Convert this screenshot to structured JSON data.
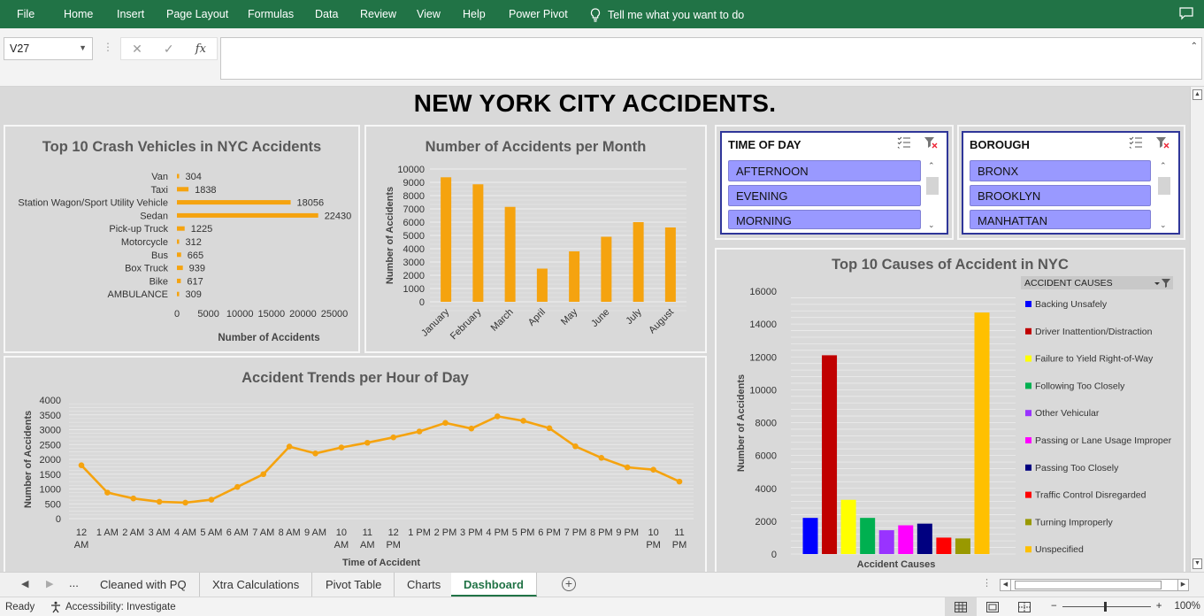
{
  "ribbon": {
    "tabs": [
      "File",
      "Home",
      "Insert",
      "Page Layout",
      "Formulas",
      "Data",
      "Review",
      "View",
      "Help",
      "Power Pivot"
    ],
    "tell_me": "Tell me what you want to do"
  },
  "formula_bar": {
    "name_box": "V27",
    "formula": ""
  },
  "dashboard": {
    "title": "NEW YORK CITY ACCIDENTS."
  },
  "slicers": [
    {
      "header": "TIME OF DAY",
      "items": [
        "AFTERNOON",
        "EVENING",
        "MORNING"
      ]
    },
    {
      "header": "BOROUGH",
      "items": [
        "BRONX",
        "BROOKLYN",
        "MANHATTAN"
      ]
    }
  ],
  "chart_data": [
    {
      "type": "bar",
      "orientation": "horizontal",
      "title": "Top 10 Crash Vehicles in NYC Accidents",
      "xlabel": "Number of Accidents",
      "ylabel": "",
      "categories": [
        "Van",
        "Taxi",
        "Station Wagon/Sport Utility Vehicle",
        "Sedan",
        "Pick-up Truck",
        "Motorcycle",
        "Bus",
        "Box Truck",
        "Bike",
        "AMBULANCE"
      ],
      "values": [
        304,
        1838,
        18056,
        22430,
        1225,
        312,
        665,
        939,
        617,
        309
      ],
      "xlim": [
        0,
        25000
      ],
      "xticks": [
        "0",
        "5000",
        "10000",
        "15000",
        "20000",
        "25000"
      ],
      "color": "#f5a30f",
      "data_labels": true
    },
    {
      "type": "bar",
      "title": "Number of Accidents per Month",
      "xlabel": "",
      "ylabel": "Number of Accidents",
      "categories": [
        "January",
        "February",
        "March",
        "April",
        "May",
        "June",
        "July",
        "August"
      ],
      "values": [
        9380,
        8850,
        7150,
        2500,
        3800,
        4900,
        6000,
        5600
      ],
      "ylim": [
        0,
        10000
      ],
      "yticks": [
        "0",
        "1000",
        "2000",
        "3000",
        "4000",
        "5000",
        "6000",
        "7000",
        "8000",
        "9000",
        "10000"
      ],
      "color": "#f5a30f"
    },
    {
      "type": "line",
      "title": "Accident Trends per Hour of Day",
      "xlabel": "Time of Accident",
      "ylabel": "Number of Accidents",
      "categories": [
        "12 AM",
        "1 AM",
        "2 AM",
        "3 AM",
        "4 AM",
        "5 AM",
        "6 AM",
        "7 AM",
        "8 AM",
        "9 AM",
        "10 AM",
        "11 AM",
        "12 PM",
        "1 PM",
        "2 PM",
        "3 PM",
        "4 PM",
        "5 PM",
        "6 PM",
        "7 PM",
        "8 PM",
        "9 PM",
        "10 PM",
        "11 PM"
      ],
      "values": [
        1800,
        880,
        680,
        570,
        540,
        640,
        1070,
        1500,
        2430,
        2200,
        2400,
        2560,
        2740,
        2940,
        3230,
        3040,
        3450,
        3300,
        3050,
        2440,
        2050,
        1730,
        1650,
        1250
      ],
      "ylim": [
        0,
        4000
      ],
      "yticks": [
        "0",
        "500",
        "1000",
        "1500",
        "2000",
        "2500",
        "3000",
        "3500",
        "4000"
      ],
      "color": "#f5a30f"
    },
    {
      "type": "bar",
      "title": "Top 10 Causes of Accident in NYC",
      "xlabel": "Accident Causes",
      "ylabel": "Number of Accidents",
      "legend_title": "ACCIDENT CAUSES",
      "legend_position": "right",
      "ylim": [
        0,
        16000
      ],
      "yticks": [
        "0",
        "2000",
        "4000",
        "6000",
        "8000",
        "10000",
        "12000",
        "14000",
        "16000"
      ],
      "series": [
        {
          "name": "Backing Unsafely",
          "value": 2200,
          "color": "#0000ff"
        },
        {
          "name": "Driver Inattention/Distraction",
          "value": 12100,
          "color": "#c00000"
        },
        {
          "name": "Failure to Yield Right-of-Way",
          "value": 3300,
          "color": "#ffff00"
        },
        {
          "name": "Following Too Closely",
          "value": 2200,
          "color": "#00b050"
        },
        {
          "name": "Other Vehicular",
          "value": 1450,
          "color": "#9933ff"
        },
        {
          "name": "Passing or Lane Usage Improper",
          "value": 1750,
          "color": "#ff00ff"
        },
        {
          "name": "Passing Too Closely",
          "value": 1850,
          "color": "#000080"
        },
        {
          "name": "Traffic Control Disregarded",
          "value": 1000,
          "color": "#ff0000"
        },
        {
          "name": "Turning Improperly",
          "value": 950,
          "color": "#999900"
        },
        {
          "name": "Unspecified",
          "value": 14700,
          "color": "#ffc000"
        }
      ]
    }
  ],
  "sheet_tabs": [
    "Cleaned with PQ",
    "Xtra Calculations",
    "Pivot Table",
    "Charts",
    "Dashboard"
  ],
  "active_sheet": "Dashboard",
  "status": {
    "ready": "Ready",
    "accessibility": "Accessibility: Investigate",
    "zoom": "100%"
  }
}
